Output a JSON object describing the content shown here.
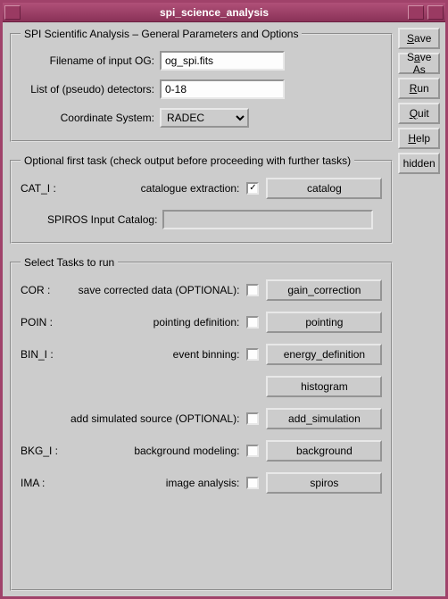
{
  "window": {
    "title": "spi_science_analysis"
  },
  "sidebar": {
    "save": "Save",
    "saveas": "Save As",
    "run": "Run",
    "quit": "Quit",
    "help": "Help",
    "hidden": "hidden"
  },
  "group_general": {
    "legend": "SPI Scientific Analysis – General Parameters and Options",
    "filename_label": "Filename of input OG:",
    "filename_value": "og_spi.fits",
    "detectors_label": "List of (pseudo) detectors:",
    "detectors_value": "0-18",
    "coord_label": "Coordinate System:",
    "coord_value": "RADEC"
  },
  "group_optional": {
    "legend": "Optional first task (check output before proceeding with further tasks)",
    "cat_prefix": "CAT_I :",
    "cat_desc": "catalogue extraction:",
    "cat_checked": "✓",
    "cat_button": "catalog",
    "spiros_label": "SPIROS Input Catalog:"
  },
  "group_tasks": {
    "legend": "Select Tasks to run",
    "rows": [
      {
        "prefix": "COR :",
        "desc": "save corrected data (OPTIONAL):",
        "btn": "gain_correction"
      },
      {
        "prefix": "POIN :",
        "desc": "pointing definition:",
        "btn": "pointing"
      },
      {
        "prefix": "BIN_I :",
        "desc": "event binning:",
        "btn": "energy_definition"
      },
      {
        "prefix": "",
        "desc": "",
        "btn": "histogram"
      },
      {
        "prefix": "",
        "desc": "add simulated source (OPTIONAL):",
        "btn": "add_simulation"
      },
      {
        "prefix": "BKG_I :",
        "desc": "background modeling:",
        "btn": "background"
      },
      {
        "prefix": "IMA :",
        "desc": "image analysis:",
        "btn": "spiros"
      }
    ]
  }
}
